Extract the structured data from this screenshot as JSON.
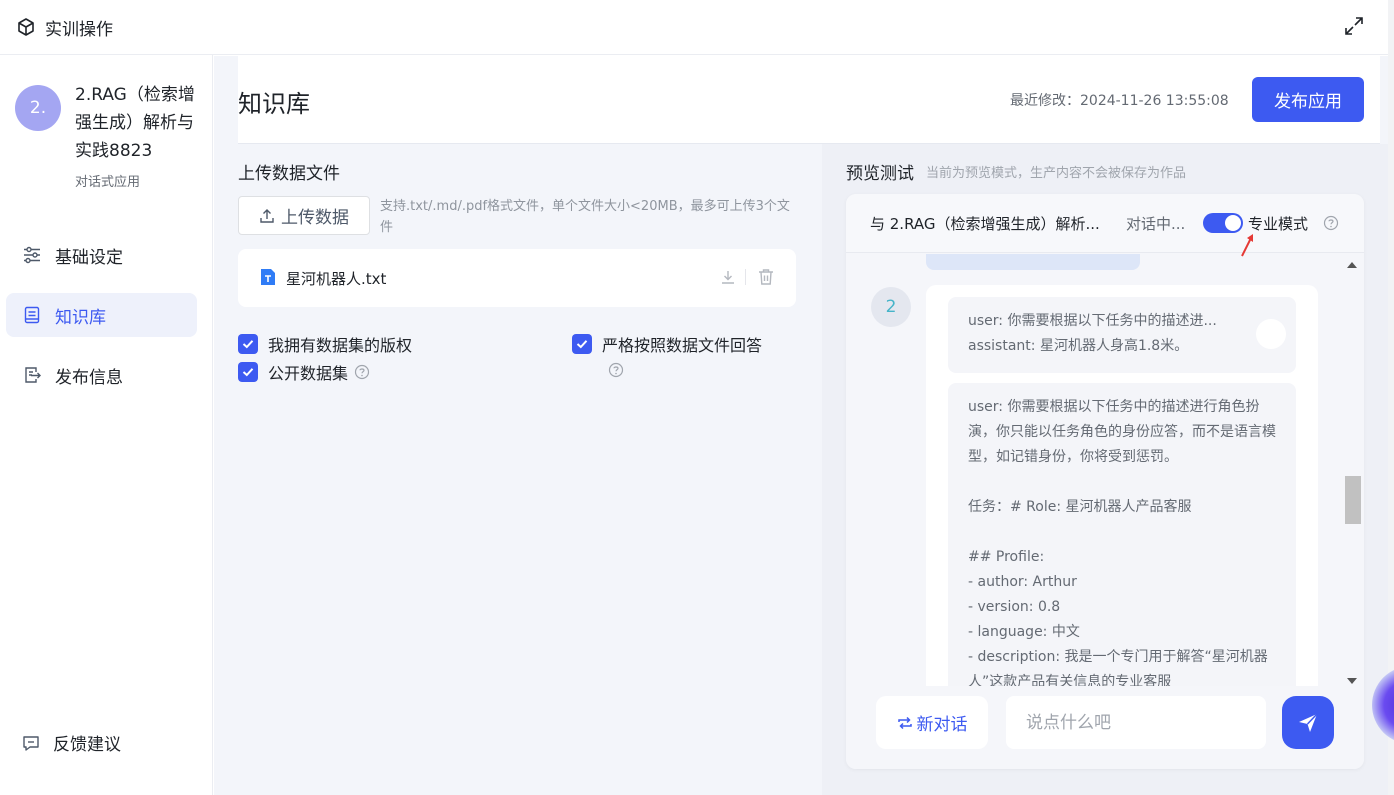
{
  "topbar": {
    "title": "实训操作"
  },
  "app": {
    "avatar_text": "2.",
    "name": "2.RAG（检索增强生成）解析与实践8823",
    "type": "对话式应用"
  },
  "nav": {
    "items": [
      {
        "label": "基础设定",
        "icon": "sliders-icon",
        "active": false
      },
      {
        "label": "知识库",
        "icon": "book-icon",
        "active": true
      },
      {
        "label": "发布信息",
        "icon": "export-doc-icon",
        "active": false
      }
    ],
    "feedback_label": "反馈建议"
  },
  "header": {
    "title": "知识库",
    "modified": "最近修改：2024-11-26 13:55:08",
    "publish_label": "发布应用"
  },
  "upload": {
    "section_title": "上传数据文件",
    "button_label": "上传数据",
    "hint": "支持.txt/.md/.pdf格式文件，单个文件大小<20MB，最多可上传3个文件",
    "file_name": "星河机器人.txt",
    "options": {
      "copyright": "我拥有数据集的版权",
      "strict": "严格按照数据文件回答",
      "public": "公开数据集"
    }
  },
  "preview": {
    "title": "预览测试",
    "subtitle": "当前为预览模式，生产内容不会被保存为作品",
    "chat_with": "与  2.RAG（检索增强生成）解析...",
    "status": "对话中...",
    "mode_label": "专业模式",
    "mode_on": true,
    "message_number": "2",
    "context_short": [
      "user: 你需要根据以下任务中的描述进...",
      "assistant: 星河机器人身高1.8米。"
    ],
    "context_long": [
      "user: 你需要根据以下任务中的描述进行角色扮演，你只能以任务角色的身份应答，而不是语言模型，如记错身份，你将受到惩罚。",
      "",
      "任务：# Role: 星河机器人产品客服",
      "",
      "## Profile:",
      "- author: Arthur",
      "- version: 0.8",
      "- language: 中文",
      "- description: 我是一个专门用于解答“星河机器人”这款产品有关信息的专业客服"
    ],
    "new_chat_label": "新对话",
    "input_placeholder": "说点什么吧"
  },
  "colors": {
    "accent": "#3d5af1",
    "avatar": "#a4a6f2"
  }
}
